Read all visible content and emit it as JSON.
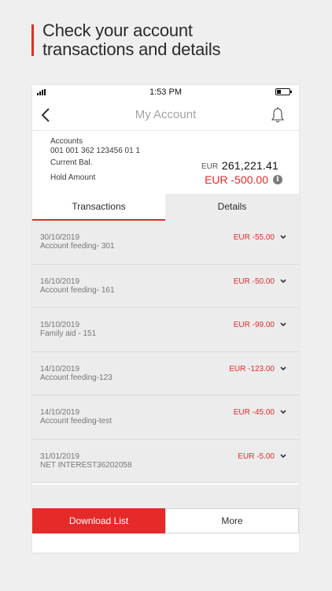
{
  "promo": {
    "line1": "Check your account",
    "line2": "transactions and details"
  },
  "status_bar": {
    "time": "1:53 PM"
  },
  "header": {
    "title": "My Account"
  },
  "account": {
    "accounts_label": "Accounts",
    "account_number": "001 001 362 123456 01 1",
    "current_bal_label": "Current Bal.",
    "hold_amount_label": "Hold Amount",
    "balance_currency": "EUR",
    "balance_amount": "261,221.41",
    "hold_amount": "EUR -500.00"
  },
  "tabs": [
    {
      "label": "Transactions",
      "active": true
    },
    {
      "label": "Details",
      "active": false
    }
  ],
  "transactions": [
    {
      "date": "30/10/2019",
      "description": "Account feeding- 301",
      "amount": "EUR -55.00"
    },
    {
      "date": "16/10/2019",
      "description": "Account feeding- 161",
      "amount": "EUR -50.00"
    },
    {
      "date": "15/10/2019",
      "description": "Family aid - 151",
      "amount": "EUR -99.00"
    },
    {
      "date": "14/10/2019",
      "description": "Account feeding-123",
      "amount": "EUR -123.00"
    },
    {
      "date": "14/10/2019",
      "description": "Account feeding-test",
      "amount": "EUR -45.00"
    },
    {
      "date": "31/01/2019",
      "description": "NET INTEREST36202058",
      "amount": "EUR -5.00"
    }
  ],
  "footer": {
    "download_label": "Download List",
    "more_label": "More"
  },
  "colors": {
    "accent": "#e52a2a",
    "row_background": "#ececec"
  }
}
